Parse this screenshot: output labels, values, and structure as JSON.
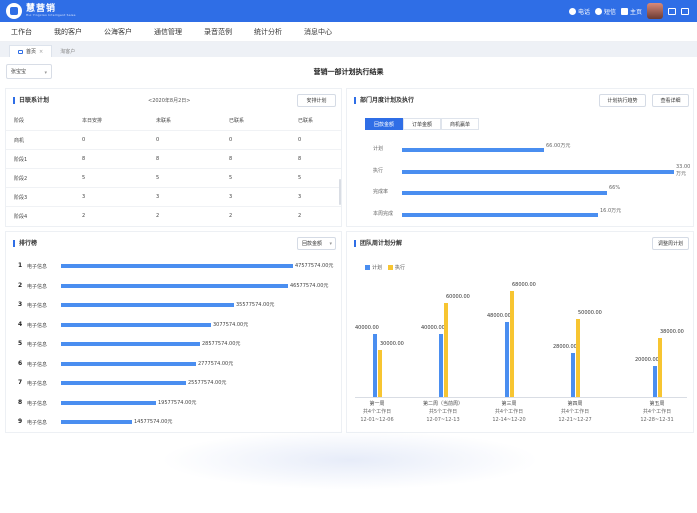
{
  "app": {
    "logo_name": "慧营销",
    "logo_sub": "Hui Yingxiao Intelligent Sales",
    "phone": "电话",
    "sms": "短信",
    "home": "主页"
  },
  "nav": [
    "工作台",
    "我的客户",
    "公海客户",
    "通信管理",
    "录音范例",
    "统计分析",
    "消息中心"
  ],
  "tabs": [
    {
      "label": "首页",
      "close": "×"
    },
    {
      "label": "淘客户"
    }
  ],
  "filter": {
    "value": "张宝宝"
  },
  "page_title": "营销一部计划执行结果",
  "daily": {
    "title": "日联系计划",
    "date": "<2020年8月2日>",
    "button": "安排计划",
    "columns": [
      "阶段",
      "本日安排",
      "未联系",
      "已联系",
      "已联系"
    ],
    "rows": [
      [
        "商机",
        "0",
        "0",
        "0",
        "0"
      ],
      [
        "阶段1",
        "8",
        "8",
        "8",
        "8"
      ],
      [
        "阶段2",
        "5",
        "5",
        "5",
        "5"
      ],
      [
        "阶段3",
        "3",
        "3",
        "3",
        "3"
      ],
      [
        "阶段4",
        "2",
        "2",
        "2",
        "2"
      ]
    ]
  },
  "monthly": {
    "title": "部门月度计划及执行",
    "btn_trend": "计划执行趋势",
    "btn_detail": "查看详细",
    "segments": [
      "回款金额",
      "订单金额",
      "商机赢单"
    ],
    "active_segment": 0,
    "metrics": [
      {
        "label": "计划",
        "value": "66.00万元",
        "fraction": 0.47
      },
      {
        "label": "执行",
        "value": "33.00万元",
        "fraction": 0.9
      },
      {
        "label": "完成率",
        "value": "66%",
        "fraction": 0.68
      },
      {
        "label": "本周完成",
        "value": "16.0万元",
        "fraction": 0.65
      }
    ]
  },
  "ranking": {
    "title": "排行榜",
    "select": "回款金额",
    "rows": [
      {
        "rank": "1",
        "name": "电子信息",
        "value": "47577574.00元",
        "amount": 47577574
      },
      {
        "rank": "2",
        "name": "电子信息",
        "value": "46577574.00元",
        "amount": 46577574
      },
      {
        "rank": "3",
        "name": "电子信息",
        "value": "35577574.00元",
        "amount": 35577574
      },
      {
        "rank": "4",
        "name": "电子信息",
        "value": "3077574.00元",
        "amount": 30775740
      },
      {
        "rank": "5",
        "name": "电子信息",
        "value": "28577574.00元",
        "amount": 28577574
      },
      {
        "rank": "6",
        "name": "电子信息",
        "value": "2777574.00元",
        "amount": 27775740
      },
      {
        "rank": "7",
        "name": "电子信息",
        "value": "25577574.00元",
        "amount": 25577574
      },
      {
        "rank": "8",
        "name": "电子信息",
        "value": "19577574.00元",
        "amount": 19577574
      },
      {
        "rank": "9",
        "name": "电子信息",
        "value": "14577574.00元",
        "amount": 14577574
      }
    ]
  },
  "weekly": {
    "title": "团队周计划分解",
    "button": "调整周计划"
  },
  "chart_data": {
    "type": "bar",
    "categories": [
      "第一周",
      "第二周（当前周）",
      "第三周",
      "第四周",
      "第五周"
    ],
    "sub_labels": [
      "共4个工作日",
      "共5个工作日",
      "共4个工作日",
      "共4个工作日",
      "共4个工作日"
    ],
    "date_ranges": [
      "12-01~12-06",
      "12-07~12-13",
      "12-14~12-20",
      "12-21~12-27",
      "12-28~12-31"
    ],
    "series": [
      {
        "name": "计划",
        "color": "#4a8ef0",
        "values": [
          40000,
          40000,
          48000,
          28000,
          20000
        ],
        "labels": [
          "40000.00",
          "40000.00",
          "48000.00",
          "28000.00",
          "20000.00"
        ]
      },
      {
        "name": "执行",
        "color": "#f7c531",
        "values": [
          30000,
          60000,
          68000,
          50000,
          38000
        ],
        "labels": [
          "30000.00",
          "60000.00",
          "68000.00",
          "50000.00",
          "38000.00"
        ]
      }
    ],
    "ylim": [
      0,
      80000
    ],
    "legend": "top-left",
    "grid": false
  }
}
